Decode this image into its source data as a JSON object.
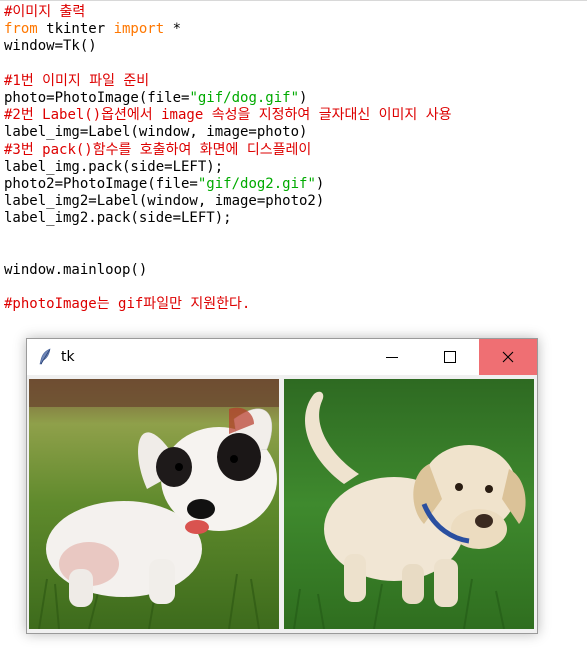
{
  "editor": {
    "lines": [
      [
        {
          "t": "#이미지 출력",
          "c": "comment"
        }
      ],
      [
        {
          "t": "from",
          "c": "keyword"
        },
        {
          "t": " tkinter ",
          "c": "normal"
        },
        {
          "t": "import",
          "c": "keyword"
        },
        {
          "t": " *",
          "c": "normal"
        }
      ],
      [
        {
          "t": "window=Tk()",
          "c": "normal"
        }
      ],
      [
        {
          "t": "",
          "c": "normal"
        }
      ],
      [
        {
          "t": "#1번 이미지 파일 준비",
          "c": "comment"
        }
      ],
      [
        {
          "t": "photo=PhotoImage(file=",
          "c": "normal"
        },
        {
          "t": "\"gif/dog.gif\"",
          "c": "string"
        },
        {
          "t": ")",
          "c": "normal"
        }
      ],
      [
        {
          "t": "#2번 Label()옵션에서 image 속성을 지정하여 글자대신 이미지 사용",
          "c": "comment"
        }
      ],
      [
        {
          "t": "label_img=Label(window, image=photo)",
          "c": "normal"
        }
      ],
      [
        {
          "t": "#3번 pack()함수를 호출하여 화면에 디스플레이",
          "c": "comment"
        }
      ],
      [
        {
          "t": "label_img.pack(side=LEFT);",
          "c": "normal"
        }
      ],
      [
        {
          "t": "photo2=PhotoImage(file=",
          "c": "normal"
        },
        {
          "t": "\"gif/dog2.gif\"",
          "c": "string"
        },
        {
          "t": ")",
          "c": "normal"
        }
      ],
      [
        {
          "t": "label_img2=Label(window, image=photo2)",
          "c": "normal"
        }
      ],
      [
        {
          "t": "label_img2.pack(side=LEFT);",
          "c": "normal"
        }
      ],
      [
        {
          "t": "",
          "c": "normal"
        }
      ],
      [
        {
          "t": "",
          "c": "normal"
        }
      ],
      [
        {
          "t": "window.mainloop()",
          "c": "normal"
        }
      ],
      [
        {
          "t": "",
          "c": "normal"
        }
      ],
      [
        {
          "t": "#photoImage는 gif파일만 지원한다.",
          "c": "comment"
        }
      ]
    ]
  },
  "tk_window": {
    "title": "tk",
    "icon": "feather-icon",
    "buttons": [
      "minimize-icon",
      "maximize-icon",
      "close-icon"
    ],
    "close_color": "#ef6f73"
  },
  "colors": {
    "comment": "#dd0000",
    "keyword": "#ff7700",
    "string": "#00aa00"
  }
}
